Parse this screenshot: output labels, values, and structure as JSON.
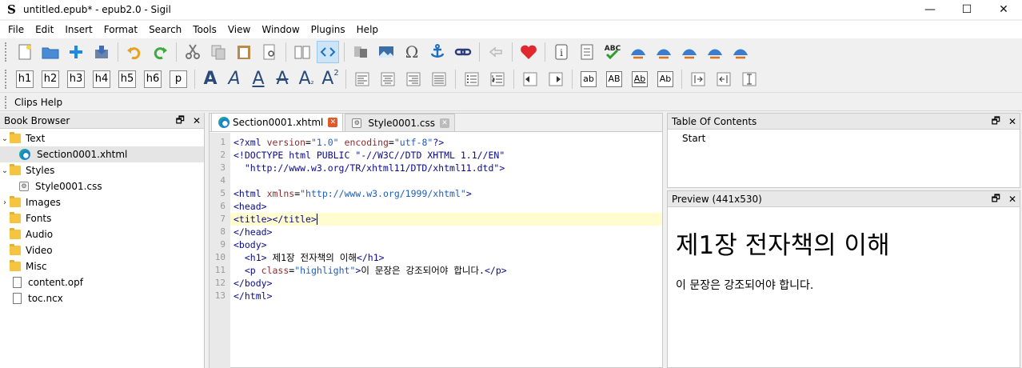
{
  "window": {
    "title": "untitled.epub* - epub2.0 - Sigil",
    "minimize": "—",
    "maximize": "☐",
    "close": "✕"
  },
  "menu": [
    "File",
    "Edit",
    "Insert",
    "Format",
    "Search",
    "Tools",
    "View",
    "Window",
    "Plugins",
    "Help"
  ],
  "toolbar": {
    "headings": [
      "h1",
      "h2",
      "h3",
      "h4",
      "h5",
      "h6",
      "p"
    ],
    "case_buttons": [
      "ab",
      "AB",
      "Ab",
      "Ab"
    ]
  },
  "clips": {
    "label": "Clips Help"
  },
  "book_browser": {
    "title": "Book Browser",
    "items": [
      {
        "label": "Text",
        "type": "folder",
        "expanded": true
      },
      {
        "label": "Section0001.xhtml",
        "type": "xhtml",
        "selected": true
      },
      {
        "label": "Styles",
        "type": "folder",
        "expanded": true
      },
      {
        "label": "Style0001.css",
        "type": "css"
      },
      {
        "label": "Images",
        "type": "folder",
        "expanded": false
      },
      {
        "label": "Fonts",
        "type": "folder"
      },
      {
        "label": "Audio",
        "type": "folder"
      },
      {
        "label": "Video",
        "type": "folder"
      },
      {
        "label": "Misc",
        "type": "folder"
      },
      {
        "label": "content.opf",
        "type": "file"
      },
      {
        "label": "toc.ncx",
        "type": "file"
      }
    ]
  },
  "editor": {
    "tabs": [
      {
        "label": "Section0001.xhtml",
        "active": true
      },
      {
        "label": "Style0001.css",
        "active": false
      }
    ],
    "line_numbers": [
      "1",
      "2",
      "3",
      "4",
      "5",
      "6",
      "7",
      "8",
      "9",
      "10",
      "11",
      "12",
      "13"
    ],
    "current_line": 7
  },
  "toc": {
    "title": "Table Of Contents",
    "items": [
      "Start"
    ]
  },
  "preview": {
    "title": "Preview (441x530)",
    "heading": "제1장 전자책의 이해",
    "paragraph": "이 문장은 강조되어야 합니다."
  },
  "colors": {
    "accent_active": "#cce4f7",
    "tab_close": "#e05b2b",
    "current_line": "#fffccf"
  }
}
